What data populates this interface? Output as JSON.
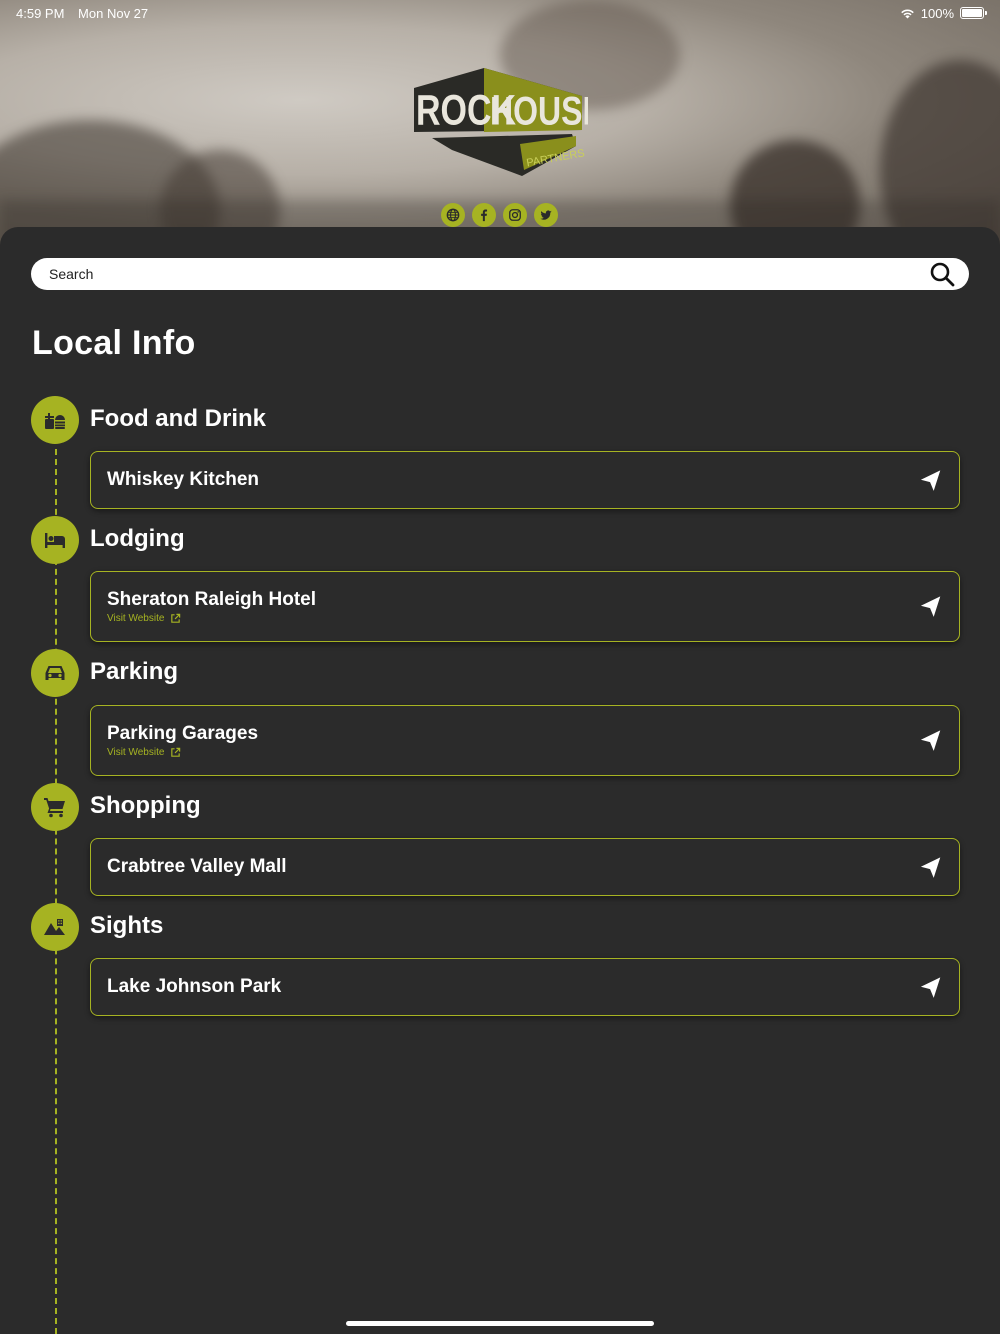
{
  "status_bar": {
    "time": "4:59 PM",
    "date": "Mon Nov 27",
    "battery": "100%"
  },
  "brand": {
    "word1": "ROCK",
    "word2": "HOUSE",
    "sub": "PARTNERS"
  },
  "search": {
    "placeholder": "Search"
  },
  "page_title": "Local Info",
  "colors": {
    "accent": "#a6b322",
    "background": "#2b2b2b"
  },
  "sections": [
    {
      "title": "Food and Drink",
      "icon": "food-icon",
      "items": [
        {
          "name": "Whiskey Kitchen"
        }
      ]
    },
    {
      "title": "Lodging",
      "icon": "bed-icon",
      "items": [
        {
          "name": "Sheraton Raleigh Hotel",
          "link": "Visit Website"
        }
      ]
    },
    {
      "title": "Parking",
      "icon": "car-icon",
      "items": [
        {
          "name": "Parking Garages",
          "link": "Visit Website"
        }
      ]
    },
    {
      "title": "Shopping",
      "icon": "cart-icon",
      "items": [
        {
          "name": "Crabtree Valley Mall"
        }
      ]
    },
    {
      "title": "Sights",
      "icon": "landscape-icon",
      "items": [
        {
          "name": "Lake Johnson Park"
        }
      ]
    }
  ]
}
